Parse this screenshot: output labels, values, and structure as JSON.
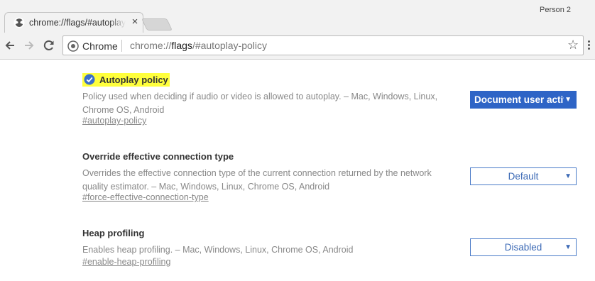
{
  "tab": {
    "title": "chrome://flags/#autoplay-policy",
    "favicon": "radiation-icon",
    "close": "×"
  },
  "profile": {
    "label": "Person 2"
  },
  "toolbar": {
    "back": "arrow-left-icon",
    "forward": "arrow-right-icon",
    "reload": "reload-icon"
  },
  "omnibox": {
    "chip": "Chrome",
    "url_scheme": "chrome://",
    "url_host": "flags",
    "url_path": "/#autoplay-policy",
    "star": "☆"
  },
  "experiments": [
    {
      "name": "Autoplay policy",
      "highlighted": true,
      "description": "Policy used when deciding if audio or video is allowed to autoplay.  – Mac, Windows, Linux, Chrome OS, Android",
      "link": "#autoplay-policy",
      "selected": "Document user activation is required."
    },
    {
      "name": "Override effective connection type",
      "highlighted": false,
      "description": "Overrides the effective connection type of the current connection returned by the network quality estimator.  – Mac, Windows, Linux, Chrome OS, Android",
      "link": "#force-effective-connection-type",
      "selected": "Default"
    },
    {
      "name": "Heap profiling",
      "highlighted": false,
      "description": "Enables heap profiling.  – Mac, Windows, Linux, Chrome OS, Android",
      "link": "#enable-heap-profiling",
      "selected": "Disabled"
    }
  ],
  "colors": {
    "highlight": "#ffff3c",
    "select_active": "#2e64c6",
    "select_border": "#4a7bc8"
  }
}
